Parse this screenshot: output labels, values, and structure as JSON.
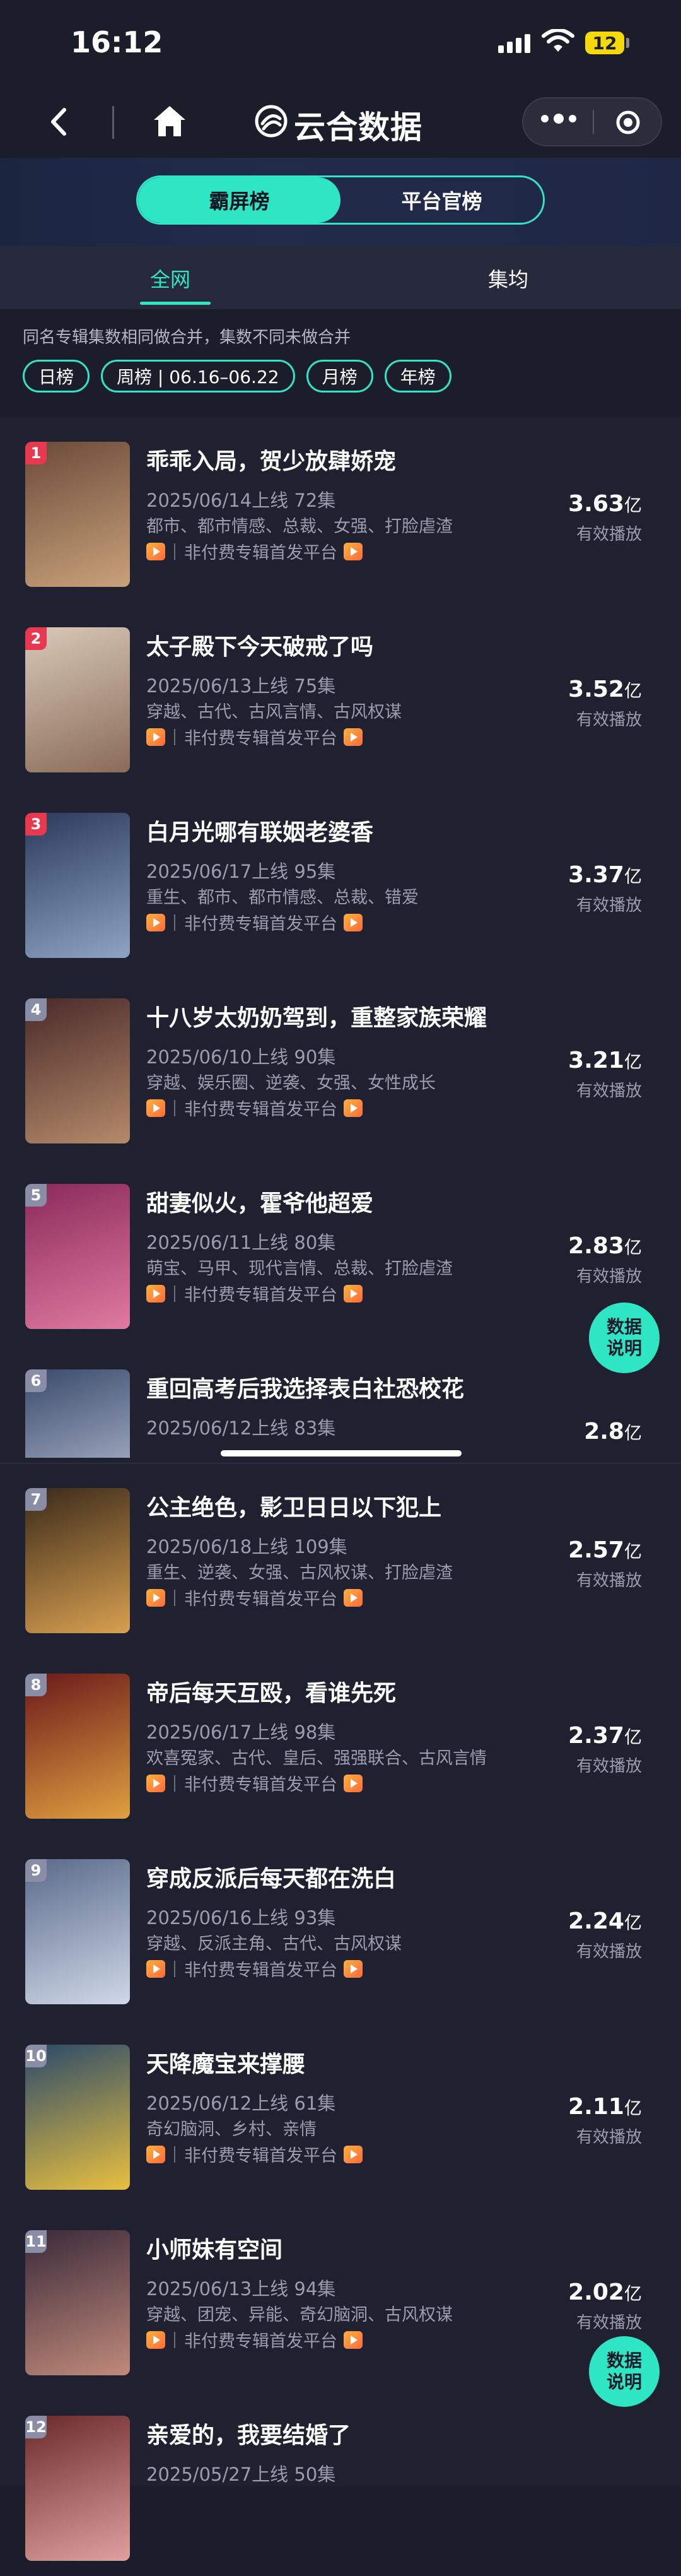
{
  "status_bar": {
    "time": "16:12",
    "battery": "12"
  },
  "nav": {
    "title": "云合数据"
  },
  "segmented": {
    "active": "霸屏榜",
    "inactive": "平台官榜"
  },
  "tabs": {
    "active": "全网",
    "inactive": "集均"
  },
  "note": "同名专辑集数相同做合并，集数不同未做合并",
  "chips": [
    "日榜",
    "周榜 | 06.16–06.22",
    "月榜",
    "年榜"
  ],
  "platform_text": "非付费专辑首发平台",
  "metric_label": "有效播放",
  "float_button": {
    "line1": "数据",
    "line2": "说明"
  },
  "rows": [
    {
      "rank": "1",
      "title": "乖乖入局，贺少放肆娇宠",
      "date": "2025/06/14上线 72集",
      "tags": "都市、都市情感、总裁、女强、打脸虐渣",
      "value": "3.63",
      "unit": "亿"
    },
    {
      "rank": "2",
      "title": "太子殿下今天破戒了吗",
      "date": "2025/06/13上线 75集",
      "tags": "穿越、古代、古风言情、古风权谋",
      "value": "3.52",
      "unit": "亿"
    },
    {
      "rank": "3",
      "title": "白月光哪有联姻老婆香",
      "date": "2025/06/17上线 95集",
      "tags": "重生、都市、都市情感、总裁、错爱",
      "value": "3.37",
      "unit": "亿"
    },
    {
      "rank": "4",
      "title": "十八岁太奶奶驾到，重整家族荣耀",
      "date": "2025/06/10上线 90集",
      "tags": "穿越、娱乐圈、逆袭、女强、女性成长",
      "value": "3.21",
      "unit": "亿"
    },
    {
      "rank": "5",
      "title": "甜妻似火，霍爷他超爱",
      "date": "2025/06/11上线 80集",
      "tags": "萌宝、马甲、现代言情、总裁、打脸虐渣",
      "value": "2.83",
      "unit": "亿"
    },
    {
      "rank": "6",
      "title": "重回高考后我选择表白社恐校花",
      "date": "2025/06/12上线 83集",
      "tags": "",
      "value": "2.8",
      "unit": "亿"
    },
    {
      "rank": "7",
      "title": "公主绝色，影卫日日以下犯上",
      "date": "2025/06/18上线 109集",
      "tags": "重生、逆袭、女强、古风权谋、打脸虐渣",
      "value": "2.57",
      "unit": "亿"
    },
    {
      "rank": "8",
      "title": "帝后每天互殴，看谁先死",
      "date": "2025/06/17上线 98集",
      "tags": "欢喜冤家、古代、皇后、强强联合、古风言情",
      "value": "2.37",
      "unit": "亿"
    },
    {
      "rank": "9",
      "title": "穿成反派后每天都在洗白",
      "date": "2025/06/16上线 93集",
      "tags": "穿越、反派主角、古代、古风权谋",
      "value": "2.24",
      "unit": "亿"
    },
    {
      "rank": "10",
      "title": "天降魔宝来撑腰",
      "date": "2025/06/12上线 61集",
      "tags": "奇幻脑洞、乡村、亲情",
      "value": "2.11",
      "unit": "亿"
    },
    {
      "rank": "11",
      "title": "小师妹有空间",
      "date": "2025/06/13上线 94集",
      "tags": "穿越、团宠、异能、奇幻脑洞、古风权谋",
      "value": "2.02",
      "unit": "亿"
    },
    {
      "rank": "12",
      "title": "亲爱的，我要结婚了",
      "date": "2025/05/27上线 50集",
      "tags": "",
      "value": "",
      "unit": ""
    }
  ],
  "colors": {
    "accent": "#2ee6c4",
    "background": "#1f2030",
    "rank_top3": "#e8384f",
    "rank_other": "#8a8da6"
  }
}
